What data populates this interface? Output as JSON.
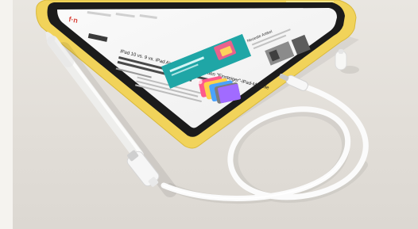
{
  "screen": {
    "site_logo": "f·n",
    "headline": "iPad 10 vs. 9 vs. iPad Air: Vergleich der neuen \"Einsteiger\"-iPad-Modelle",
    "sidebar_heading": "Neueste Artikel"
  },
  "colors": {
    "background": "#e4e0da",
    "ipad_frame": "#f1d35a",
    "ipad_screen_border": "#1b1b1b",
    "site_accent": "#d9443a",
    "banner": "#1fa6a6",
    "cable": "#fbfbfb",
    "pencil": "#f7f7f5"
  }
}
